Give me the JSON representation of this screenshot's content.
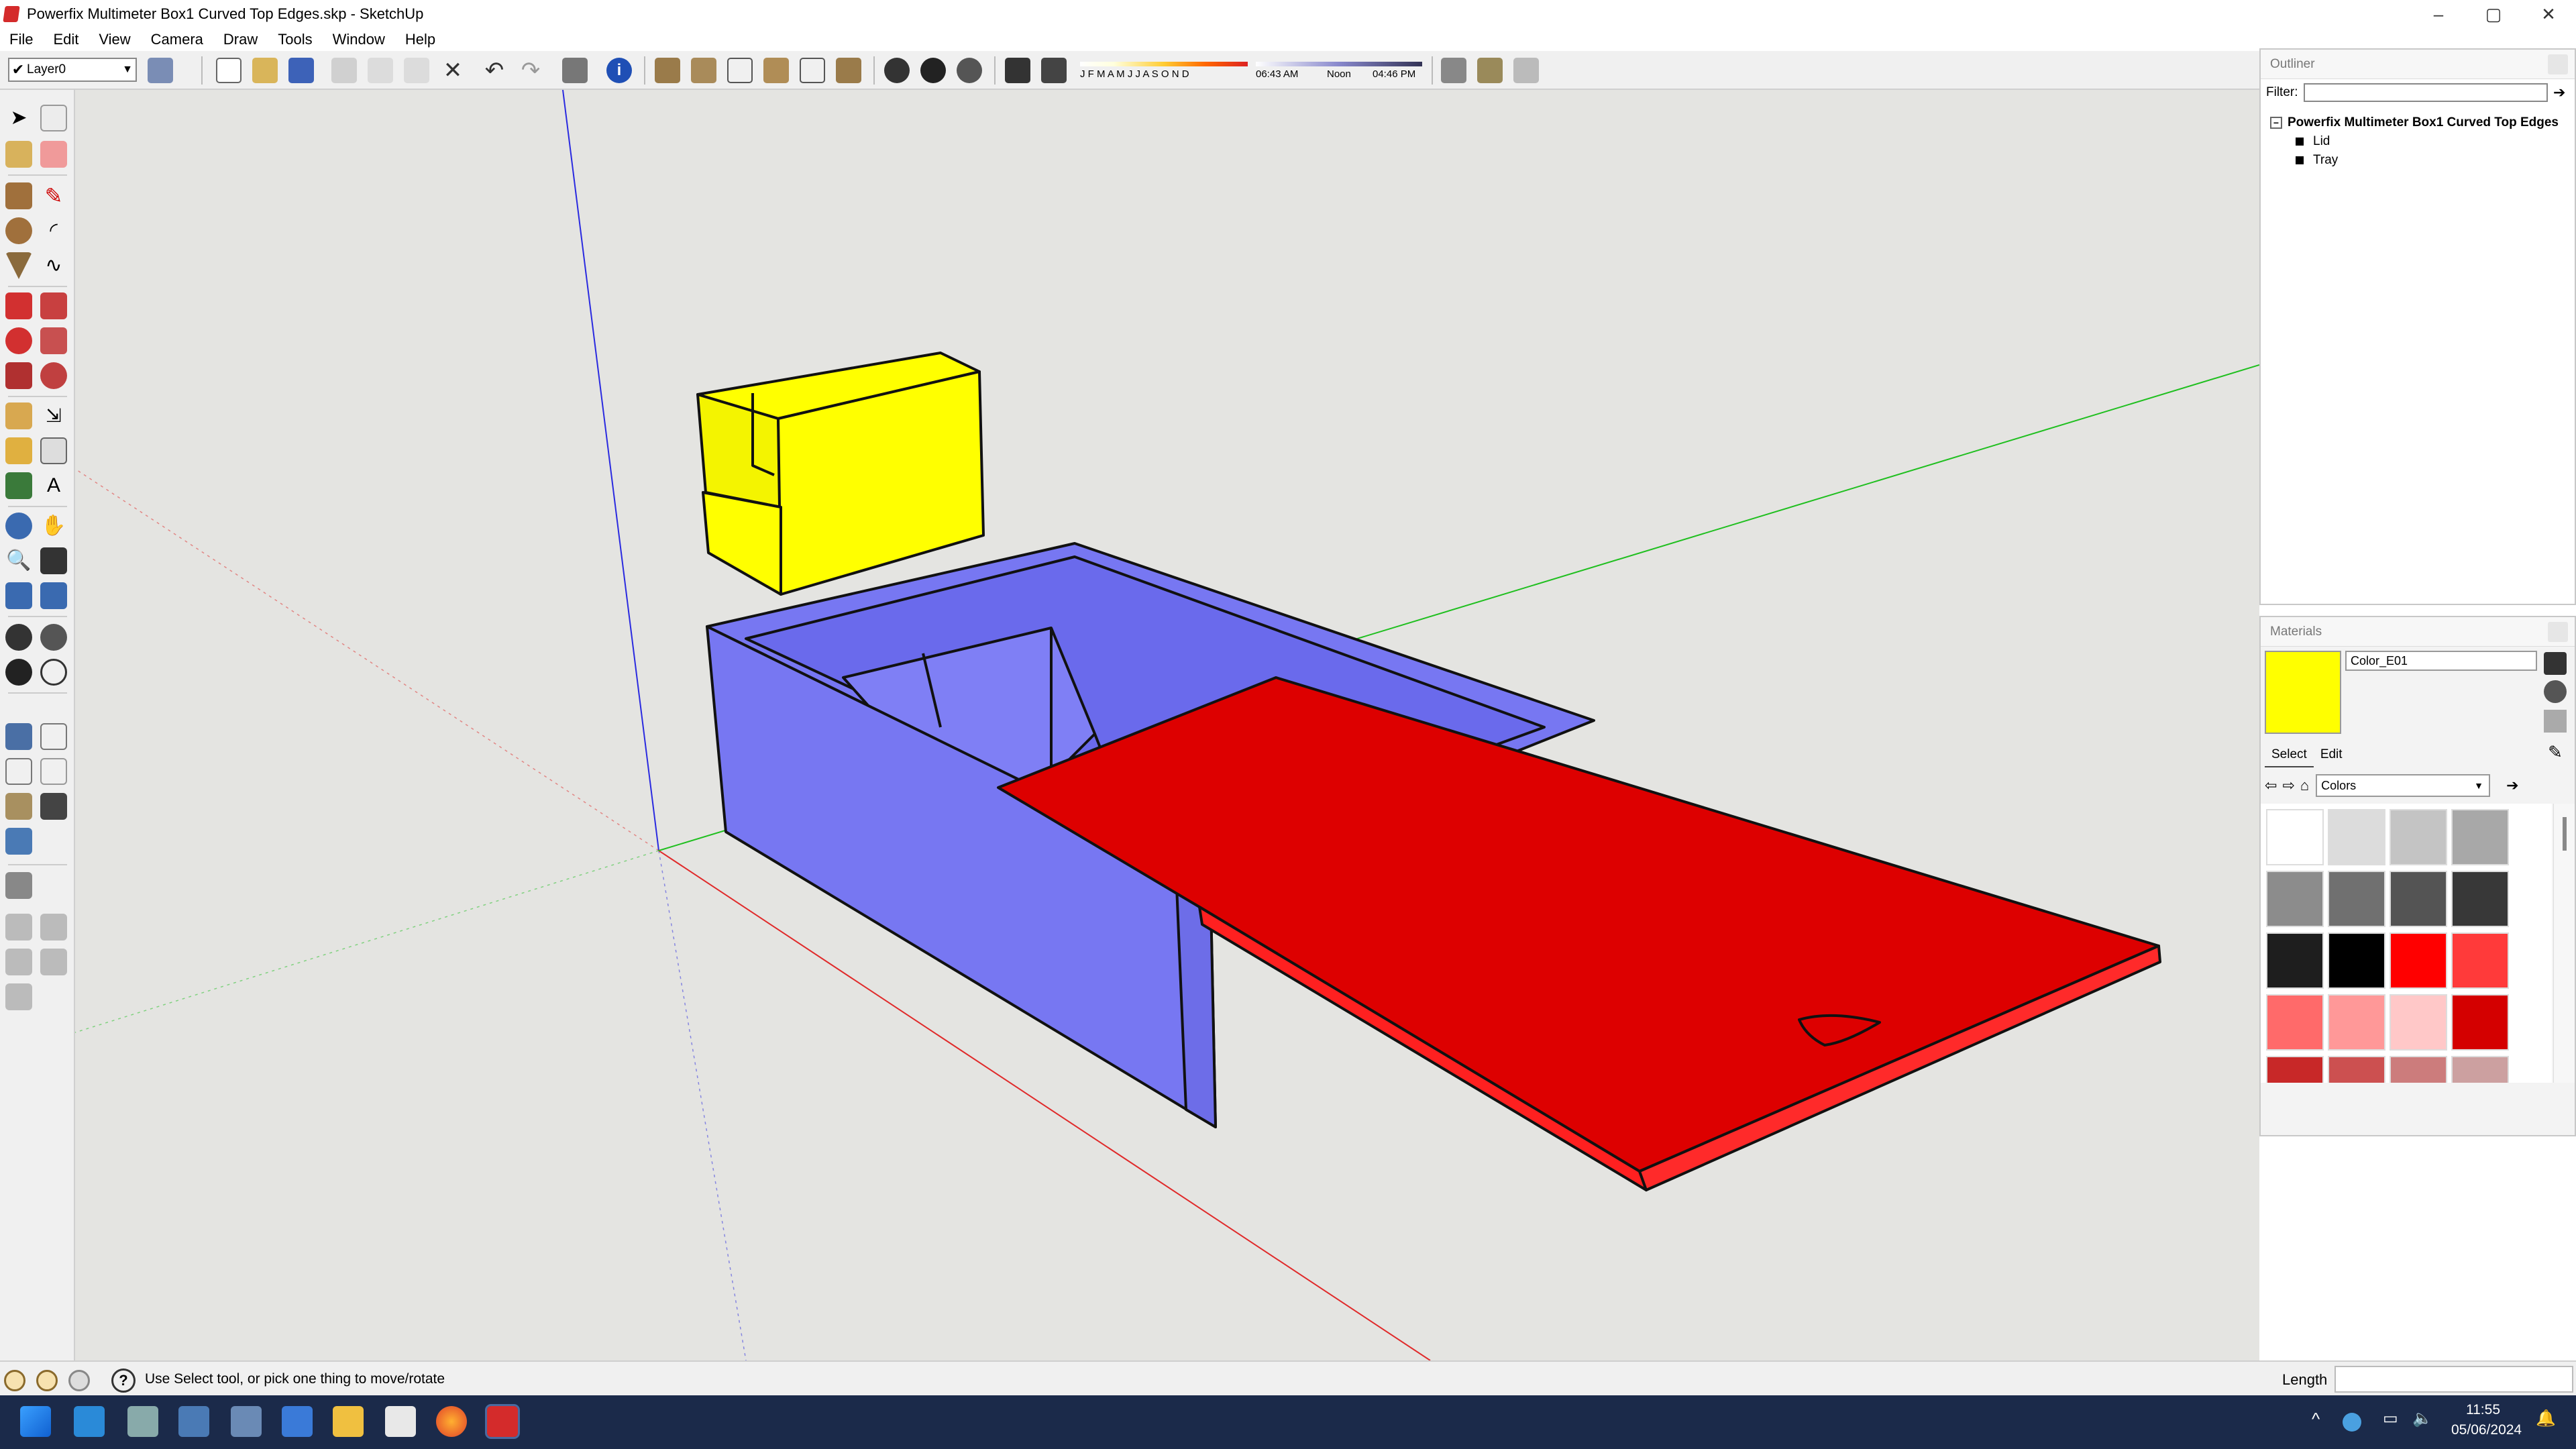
{
  "window": {
    "title": "Powerfix Multimeter Box1 Curved Top Edges.skp - SketchUp"
  },
  "window_controls": {
    "minimize": "–",
    "maximize": "▢",
    "close": "✕"
  },
  "menu": [
    "File",
    "Edit",
    "View",
    "Camera",
    "Draw",
    "Tools",
    "Window",
    "Help"
  ],
  "toolbar": {
    "layer": "Layer0",
    "shadow": {
      "months": "J F M A M J J A S O N D",
      "time_start": "06:43 AM",
      "time_mid": "Noon",
      "time_end": "04:46 PM"
    }
  },
  "outliner": {
    "title": "Outliner",
    "filter_label": "Filter:",
    "filter_value": "",
    "model_name": "Powerfix Multimeter Box1 Curved Top Edges",
    "children": [
      "Lid",
      "Tray"
    ]
  },
  "materials": {
    "title": "Materials",
    "current_name": "Color_E01",
    "current_color": "#ffff00",
    "tab_select": "Select",
    "tab_edit": "Edit",
    "collection": "Colors",
    "swatches": [
      "#ffffff",
      "#dcdcdc",
      "#c4c4c4",
      "#a8a8a8",
      "#8c8c8c",
      "#707070",
      "#545454",
      "#383838",
      "#1e1e1e",
      "#000000",
      "#ff0000",
      "#ff3a3a",
      "#ff6a6a",
      "#ff9898",
      "#ffc8c8",
      "#d40000",
      "#c82828",
      "#cc5050",
      "#cc7c7c",
      "#cca0a0",
      "#9a0000",
      "#9a1a1a",
      "#9a3a3a",
      "#9a5a5a"
    ]
  },
  "status": {
    "hint": "Use Select tool, or pick one thing to move/rotate",
    "length_label": "Length",
    "length_value": ""
  },
  "taskbar": {
    "time": "11:55",
    "date": "05/06/2024"
  },
  "model": {
    "lid_color": "#ff0000",
    "tray_color": "#7777f2",
    "insert_color": "#ffff00"
  }
}
